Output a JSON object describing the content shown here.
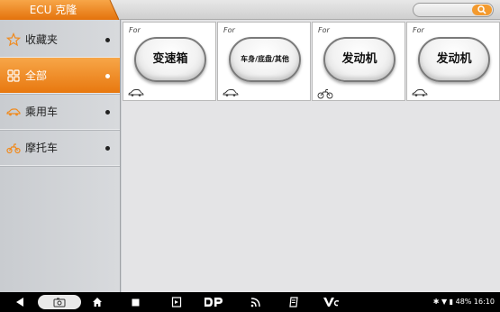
{
  "header": {
    "title": "ECU 克隆",
    "accent_color": "#f08a1e",
    "search_icon": "search-icon"
  },
  "sidebar": {
    "items": [
      {
        "label": "收藏夹",
        "icon": "star-icon",
        "active": false
      },
      {
        "label": "全部",
        "icon": "grid-icon",
        "active": true
      },
      {
        "label": "乘用车",
        "icon": "car-icon",
        "active": false
      },
      {
        "label": "摩托车",
        "icon": "motorcycle-icon",
        "active": false
      }
    ]
  },
  "cards": [
    {
      "for_label": "For",
      "title": "变速箱",
      "vehicle": "car-icon"
    },
    {
      "for_label": "For",
      "title": "车身/底盘/其他",
      "vehicle": "car-icon"
    },
    {
      "for_label": "For",
      "title": "发动机",
      "vehicle": "motorcycle-icon"
    },
    {
      "for_label": "For",
      "title": "发动机",
      "vehicle": "car-icon"
    }
  ],
  "navbar": {
    "icons": [
      "back-icon",
      "screenshot-icon",
      "home-icon",
      "recents-icon",
      "vci-manager-icon",
      "dp-icon",
      "wireless-icon",
      "clipboard-icon",
      "vci-icon"
    ],
    "status_text": "48% 16:10"
  }
}
